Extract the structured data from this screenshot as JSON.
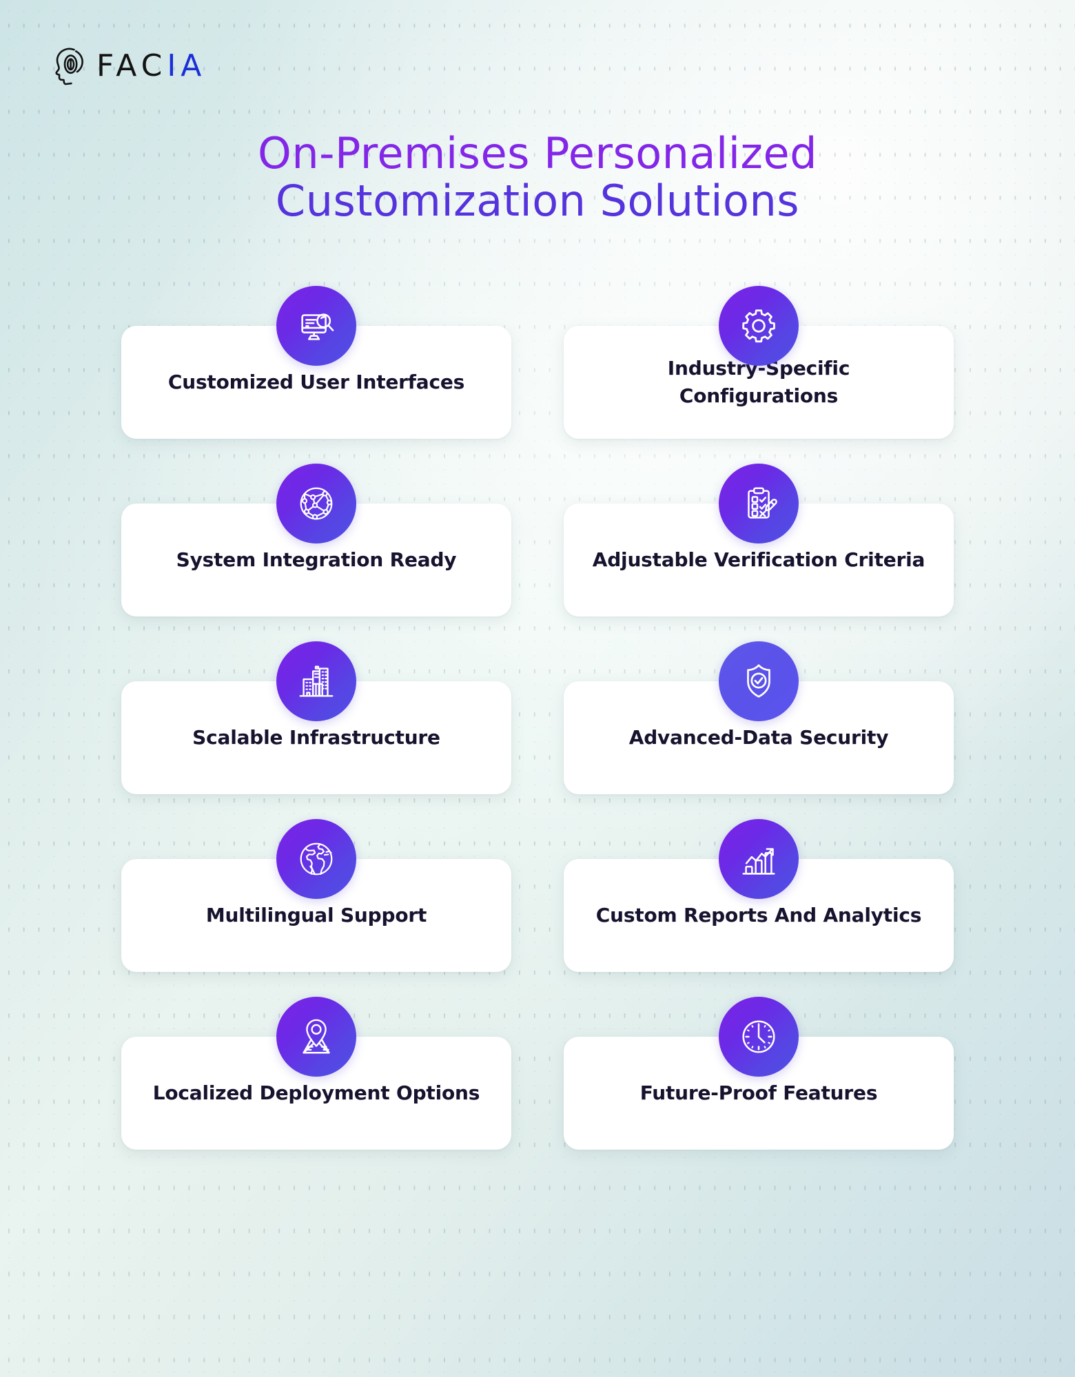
{
  "brand": {
    "name_part1": "FAC",
    "name_part2": "IA",
    "logo_icon": "fingerprint-head-icon",
    "color_primary": "#131313",
    "color_accent": "#1b2fd6"
  },
  "title": {
    "line1": "On-Premises Personalized",
    "line2": "Customization Solutions",
    "color_line1": "#8326e8",
    "color_line2": "#5533dd"
  },
  "theme": {
    "background_start": "#cde4e6",
    "background_end": "#c9dde4",
    "card_background": "#ffffff",
    "card_text": "#16132e",
    "icon_gradient_start": "#7d23e8",
    "icon_gradient_end": "#4f50e6"
  },
  "features": [
    {
      "label": "Customized User Interfaces",
      "icon": "monitor-search-icon",
      "icon_style": "gradient"
    },
    {
      "label": "Industry-Specific Configurations",
      "icon": "gear-icon",
      "icon_style": "gradient"
    },
    {
      "label": "System Integration Ready",
      "icon": "network-globe-icon",
      "icon_style": "gradient"
    },
    {
      "label": "Adjustable Verification Criteria",
      "icon": "clipboard-check-pencil-icon",
      "icon_style": "gradient"
    },
    {
      "label": "Scalable Infrastructure",
      "icon": "buildings-icon",
      "icon_style": "gradient"
    },
    {
      "label": "Advanced-Data Security",
      "icon": "shield-check-icon",
      "icon_style": "flat"
    },
    {
      "label": "Multilingual Support",
      "icon": "earth-globe-icon",
      "icon_style": "gradient"
    },
    {
      "label": "Custom Reports And Analytics",
      "icon": "bar-chart-growth-icon",
      "icon_style": "gradient"
    },
    {
      "label": "Localized Deployment Options",
      "icon": "map-pin-icon",
      "icon_style": "gradient"
    },
    {
      "label": "Future-Proof Features",
      "icon": "clock-icon",
      "icon_style": "gradient"
    }
  ]
}
